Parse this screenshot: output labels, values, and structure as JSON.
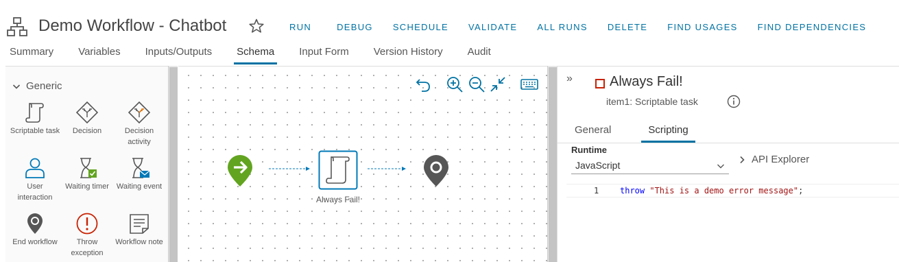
{
  "header": {
    "title": "Demo Workflow - Chatbot",
    "actions": [
      "RUN",
      "DEBUG",
      "SCHEDULE",
      "VALIDATE",
      "ALL RUNS",
      "DELETE",
      "FIND USAGES",
      "FIND DEPENDENCIES"
    ]
  },
  "tabs": [
    {
      "label": "Summary"
    },
    {
      "label": "Variables"
    },
    {
      "label": "Inputs/Outputs"
    },
    {
      "label": "Schema",
      "active": true
    },
    {
      "label": "Input Form"
    },
    {
      "label": "Version History"
    },
    {
      "label": "Audit"
    }
  ],
  "palette": {
    "group": "Generic",
    "items": [
      {
        "label": "Scriptable task",
        "icon": "scriptable-task-icon"
      },
      {
        "label": "Decision",
        "icon": "decision-icon"
      },
      {
        "label": "Decision activity",
        "icon": "decision-activity-icon"
      },
      {
        "label": "User interaction",
        "icon": "user-interaction-icon"
      },
      {
        "label": "Waiting timer",
        "icon": "waiting-timer-icon"
      },
      {
        "label": "Waiting event",
        "icon": "waiting-event-icon"
      },
      {
        "label": "End workflow",
        "icon": "end-workflow-icon"
      },
      {
        "label": "Throw exception",
        "icon": "throw-exception-icon"
      },
      {
        "label": "Workflow note",
        "icon": "workflow-note-icon"
      }
    ]
  },
  "canvas": {
    "tools": [
      "undo-icon",
      "zoom-in-icon",
      "zoom-out-icon",
      "fit-to-screen-icon",
      "keyboard-icon"
    ],
    "node_label": "Always Fail!"
  },
  "details": {
    "title": "Always Fail!",
    "subtitle": "item1: Scriptable task",
    "tabs": [
      "General",
      "Scripting"
    ],
    "active_tab": "Scripting",
    "runtime_label": "Runtime",
    "runtime_value": "JavaScript",
    "api_explorer": "API Explorer",
    "code": {
      "line_number": "1",
      "keyword": "throw",
      "string": "\"This is a demo error message\"",
      "end": ";"
    }
  },
  "colors": {
    "accent": "#0072a3",
    "start_node": "#62a420",
    "end_node": "#565656",
    "error_red": "#c92100"
  }
}
